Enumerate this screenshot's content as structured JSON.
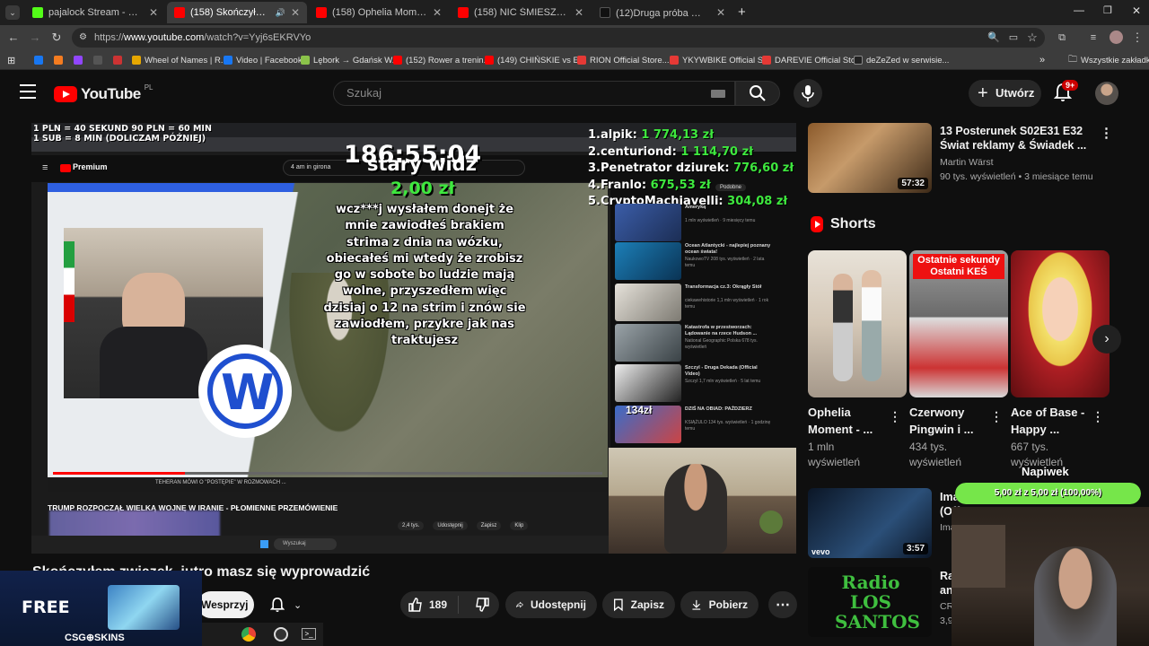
{
  "tabs": [
    {
      "label": "pajalock Stream - Watch Live o",
      "color": "#53fc18"
    },
    {
      "label": "(158) Skończyłem związek",
      "color": "#ff0000"
    },
    {
      "label": "(158) Ophelia Moment - The Fa",
      "color": "#ff0000"
    },
    {
      "label": "(158) NIC ŚMIESZNEGO | FILM",
      "color": "#ff0000"
    },
    {
      "label": "(12)Druga próba 😊 | TikTok",
      "color": "#111111"
    }
  ],
  "address": {
    "prefix": "https://",
    "host": "www.youtube.com",
    "path": "/watch?v=Yyj6sEKRVYo"
  },
  "bookmarks": [
    "Wheel of Names | R...",
    "Video | Facebook",
    "Lębork → Gdańsk W...",
    "(152) Rower a trenin...",
    "(149) CHIŃSKIE vs E...",
    "RION Official Store...",
    "YKYWBIKE Official S...",
    "DAREVIE Official Sto...",
    "deZeZed w serwisie...",
    "Wszystkie zakładki"
  ],
  "yt": {
    "logo": "YouTube",
    "country": "PL",
    "search_placeholder": "Szukaj",
    "create_label": "Utwórz",
    "notif_badge": "9+"
  },
  "stream_overlay": {
    "rate_line1": "1 PLN = 40 SEKUND 90 PLN = 60 MIN",
    "rate_line2": "1 SUB = 8 MIN (DOLICZAM PÓŹNIEJ)",
    "timer": "186:55:04",
    "donor_name": "stary widz",
    "donor_amount": "2,00 zł",
    "donation_message": "wcz***j wysłałem donejt że mnie zawiodłeś brakiem strima z dnia na wózku, obiecałeś mi wtedy że zrobisz go w sobote bo ludzie mają wolne, przyszedłem więc dzisiaj o 12 na strim i znów sie zawiodłem, przykre jak nas traktujesz",
    "leaderboard": [
      {
        "rank": "1.",
        "name": "alpik:",
        "amount": "1 774,13 zł"
      },
      {
        "rank": "2.",
        "name": "centuriond:",
        "amount": "1 114,70 zł"
      },
      {
        "rank": "3.",
        "name": "Penetrator dziurek:",
        "amount": "776,60 zł"
      },
      {
        "rank": "4.",
        "name": "Franlo:",
        "amount": "675,53 zł"
      },
      {
        "rank": "5.",
        "name": "CryptoMachiavelli:",
        "amount": "304,08 zł"
      }
    ],
    "napiwek_label": "Napiwek",
    "napiwek_progress": "5,00 zł z 5,00 zł (100,00%)",
    "napiwek_fraction": 1.0,
    "csgo_free": "FREE",
    "csgo_brand": "CSG⊕SKINS"
  },
  "inner_screen": {
    "premium_label": "Premium",
    "search_text": "4 am in girona",
    "video_caption": "TEHERAN MÓWI O \"POSTĘPIE\" W ROZMOWACH ...",
    "headline": "TRUMP ROZPOCZĄŁ WIELKĄ WOJNĘ W IRANIE - PŁOMIENNE PRZEMÓWIENIE",
    "like_count": "2,4 tys.",
    "share": "Udostępnij",
    "save": "Zapisz",
    "clip": "Klip",
    "taskbar_search": "Wyszukaj",
    "list": [
      {
        "title": "Ameryką",
        "meta": "1 mln wyświetleń · 9 miesięcy temu",
        "dur": "52:57"
      },
      {
        "title": "Ocean Atlantycki - najlepiej poznany ocean świata!",
        "meta": "NaukowoTV 208 tys. wyświetleń · 2 lata temu",
        "dur": "46:32"
      },
      {
        "title": "Transformacja cz.3: Okrągły Stół",
        "meta": "ciekawehistorie 1,1 mln wyświetleń · 1 rok temu",
        "dur": "36:26"
      },
      {
        "title": "Katastrofa w przestworzach: Lądowanie na rzece Hudson ...",
        "meta": "National Geographic Polska 678 tys. wyświetleń",
        "dur": "45:15"
      },
      {
        "title": "Szczyl - Druga Dekada (Official Video)",
        "meta": "Szczyl 1,7 mln wyświetleń · 5 lat temu",
        "dur": "4:38"
      },
      {
        "title": "DZIŚ NA OBIAD: PAŹDZIERZ",
        "meta": "KSIĄŻULO 134 tys. wyświetleń · 1 godzinę temu",
        "dur": "22:44"
      }
    ],
    "list_badge": "134zł",
    "chip": "Podobne"
  },
  "sidebar": {
    "top_video": {
      "title": "13 Posterunek S02E31 E32 Świat reklamy & Świadek ...",
      "channel": "Martin Wärst",
      "meta": "90 tys. wyświetleń • 3 miesiące temu",
      "duration": "57:32"
    },
    "shorts_heading": "Shorts",
    "shorts": [
      {
        "title": "Ophelia Moment - ...",
        "views": "1 mln wyświetleń",
        "overlay": ""
      },
      {
        "title": "Czerwony Pingwin i ...",
        "views": "434 tys. wyświetleń",
        "overlay": "Ostatnie sekundy Ostatni KEŚ"
      },
      {
        "title": "Ace of Base - Happy ...",
        "views": "667 tys. wyświetleń",
        "overlay": ""
      }
    ],
    "next_items": [
      {
        "title": "Ima",
        "sub": "(Off",
        "meta": "Ima",
        "duration": "3:57",
        "brand": "vevo"
      },
      {
        "title": "Ra",
        "sub": "an",
        "meta": "CR",
        "meta2": "3,9",
        "brand": "Radio LOS SANTOS"
      }
    ]
  },
  "video": {
    "title": "Skończyłem związek, jutro masz się wyprowadzić",
    "support_label": "Wesprzyj",
    "like_count": "189",
    "share_label": "Udostępnij",
    "save_label": "Zapisz",
    "download_label": "Pobierz"
  }
}
